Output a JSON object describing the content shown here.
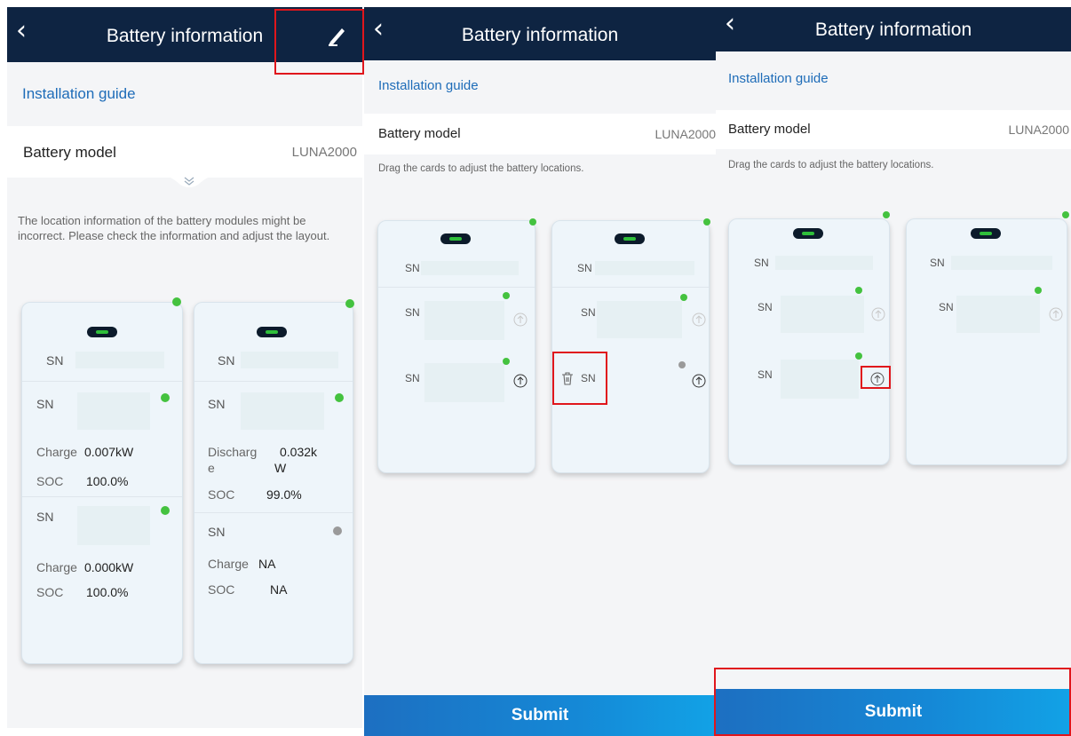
{
  "screen1": {
    "title": "Battery information",
    "back_icon": "chevron-left-icon",
    "edit_icon": "pencil-icon",
    "installation_guide": "Installation guide",
    "battery_model_label": "Battery model",
    "battery_model_value": "LUNA2000",
    "note": "The location information of the battery modules might be incorrect. Please check the information and adjust the layout.",
    "cards": [
      {
        "sn_label": "SN",
        "modules": [
          {
            "sn_label": "SN",
            "mode_label": "Charge",
            "mode_value": "0.007kW",
            "soc_label": "SOC",
            "soc_value": "100.0%"
          },
          {
            "sn_label": "SN",
            "mode_label": "Charge",
            "mode_value": "0.000kW",
            "soc_label": "SOC",
            "soc_value": "100.0%"
          }
        ]
      },
      {
        "sn_label": "SN",
        "modules": [
          {
            "sn_label": "SN",
            "mode_label_1": "Discharg",
            "mode_label_2": "e",
            "mode_value_1": "0.032k",
            "mode_value_2": "W",
            "soc_label": "SOC",
            "soc_value": "99.0%"
          },
          {
            "sn_label": "SN",
            "mode_label": "Charge",
            "mode_value": "NA",
            "soc_label": "SOC",
            "soc_value": "NA"
          }
        ]
      }
    ]
  },
  "screen2": {
    "title": "Battery information",
    "installation_guide": "Installation guide",
    "battery_model_label": "Battery model",
    "battery_model_value": "LUNA2000",
    "hint": "Drag the cards to adjust the battery locations.",
    "card1": {
      "sn_label": "SN",
      "module1_sn": "SN",
      "module2_sn": "SN"
    },
    "card2": {
      "sn_label": "SN",
      "module1_sn": "SN",
      "module2_sn": "SN"
    },
    "submit": "Submit"
  },
  "screen3": {
    "title": "Battery information",
    "installation_guide": "Installation guide",
    "battery_model_label": "Battery model",
    "battery_model_value": "LUNA2000",
    "hint": "Drag the cards to adjust the battery locations.",
    "card1": {
      "sn_label": "SN",
      "module1_sn": "SN",
      "module2_sn": "SN"
    },
    "card2": {
      "sn_label": "SN",
      "module1_sn": "SN"
    },
    "submit": "Submit"
  },
  "colors": {
    "header": "#0e2442",
    "link": "#1e6cb8",
    "status_online": "#44c23f",
    "status_offline": "#9a9a9a",
    "highlight": "#e0161c",
    "submit_gradient": [
      "#1d6fc1",
      "#12a2e6"
    ]
  }
}
